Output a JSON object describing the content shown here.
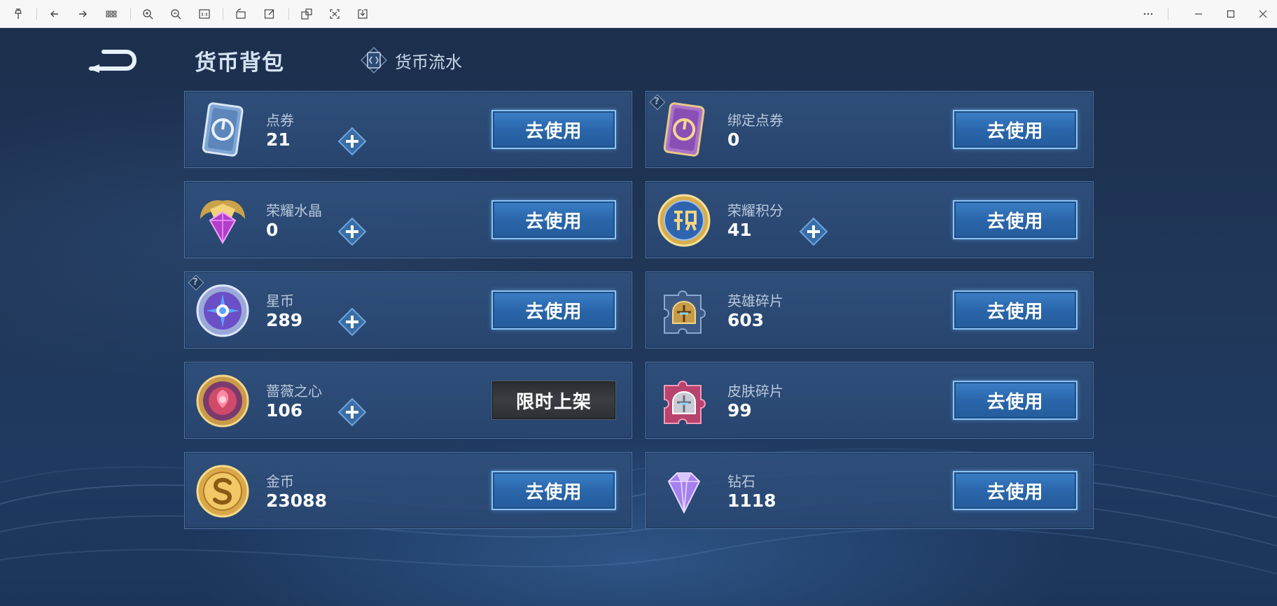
{
  "viewer_toolbar": {
    "left_tools": [
      "pin-icon",
      "arrow-left-icon",
      "arrow-right-icon",
      "grid-icon",
      "zoom-in-icon",
      "zoom-out-icon",
      "actual-size-icon",
      "rotate-icon",
      "edit-icon",
      "screenshot-icon",
      "crop-icon",
      "save-icon"
    ],
    "right_tools": [
      "more-icon",
      "minimize-icon",
      "maximize-icon",
      "close-icon"
    ]
  },
  "header": {
    "title": "货币背包",
    "flow_tab_label": "货币流水"
  },
  "colors": {
    "accent": "#3c80c8",
    "card_border": "#4f76a8",
    "background": "#203757"
  },
  "cards": [
    {
      "name": "点券",
      "amount": "21",
      "icon": "coupon-icon",
      "button": "去使用",
      "plus": true,
      "help": false
    },
    {
      "name": "绑定点券",
      "amount": "0",
      "icon": "bound-coupon-icon",
      "button": "去使用",
      "plus": false,
      "help": true
    },
    {
      "name": "荣耀水晶",
      "amount": "0",
      "icon": "glory-crystal-icon",
      "button": "去使用",
      "plus": true,
      "help": false
    },
    {
      "name": "荣耀积分",
      "amount": "41",
      "icon": "glory-points-icon",
      "button": "去使用",
      "plus": true,
      "help": false
    },
    {
      "name": "星币",
      "amount": "289",
      "icon": "star-coin-icon",
      "button": "去使用",
      "plus": true,
      "help": true
    },
    {
      "name": "英雄碎片",
      "amount": "603",
      "icon": "hero-fragment-icon",
      "button": "去使用",
      "plus": false,
      "help": false
    },
    {
      "name": "蔷薇之心",
      "amount": "106",
      "icon": "rose-heart-icon",
      "button": "限时上架",
      "plus": true,
      "help": false
    },
    {
      "name": "皮肤碎片",
      "amount": "99",
      "icon": "skin-fragment-icon",
      "button": "去使用",
      "plus": false,
      "help": false
    },
    {
      "name": "金币",
      "amount": "23088",
      "icon": "gold-coin-icon",
      "button": "去使用",
      "plus": false,
      "help": false
    },
    {
      "name": "钻石",
      "amount": "1118",
      "icon": "diamond-icon",
      "button": "去使用",
      "plus": false,
      "help": false
    }
  ],
  "help_mark": "?",
  "window_icons_note": ""
}
